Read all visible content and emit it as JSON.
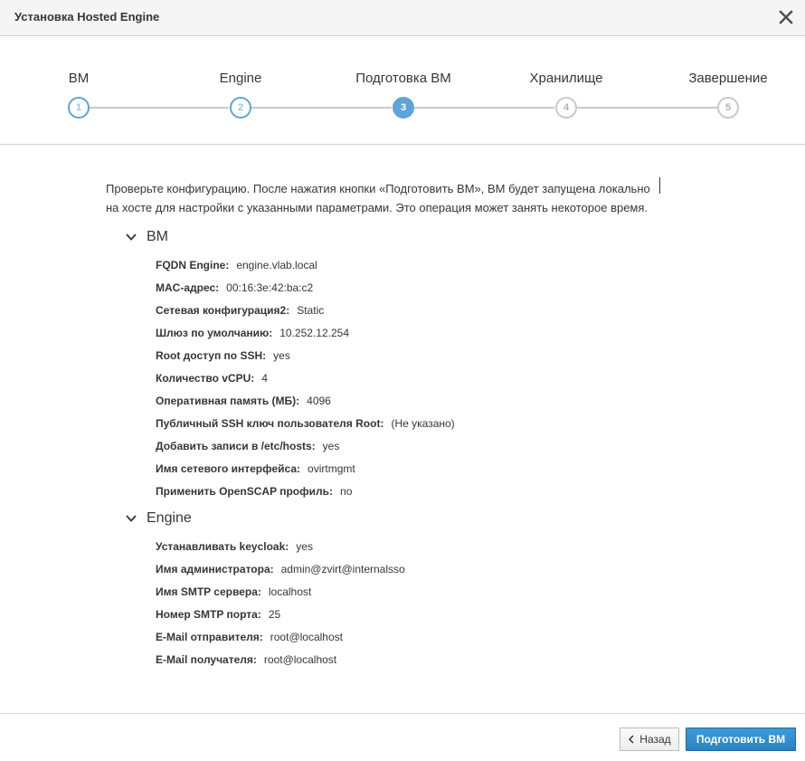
{
  "dialog": {
    "title": "Установка Hosted Engine"
  },
  "steps": [
    {
      "label": "ВМ",
      "number": "1",
      "state": "done"
    },
    {
      "label": "Engine",
      "number": "2",
      "state": "done"
    },
    {
      "label": "Подготовка ВМ",
      "number": "3",
      "state": "current"
    },
    {
      "label": "Хранилище",
      "number": "4",
      "state": "todo"
    },
    {
      "label": "Завершение",
      "number": "5",
      "state": "todo"
    }
  ],
  "intro": {
    "line1": "Проверьте конфигурацию. После нажатия кнопки «Подготовить ВМ», ВМ будет запущена локально",
    "line2": "на хосте для настройки с указанными параметрами. Это операция может занять некоторое время."
  },
  "vm_section": {
    "title": "ВМ",
    "rows": [
      {
        "key": "FQDN Engine:",
        "value": "engine.vlab.local"
      },
      {
        "key": "MAC-адрес:",
        "value": "00:16:3e:42:ba:c2"
      },
      {
        "key": "Сетевая конфигурация2:",
        "value": "Static"
      },
      {
        "key": "Шлюз по умолчанию:",
        "value": "10.252.12.254"
      },
      {
        "key": "Root доступ по SSH:",
        "value": "yes"
      },
      {
        "key": "Количество vCPU:",
        "value": "4"
      },
      {
        "key": "Оперативная память (МБ):",
        "value": "4096"
      },
      {
        "key": "Публичный SSH ключ пользователя Root:",
        "value": "(Не указано)"
      },
      {
        "key": "Добавить записи в /etc/hosts:",
        "value": "yes"
      },
      {
        "key": "Имя сетевого интерфейса:",
        "value": "ovirtmgmt"
      },
      {
        "key": "Применить OpenSCAP профиль:",
        "value": "no"
      }
    ]
  },
  "engine_section": {
    "title": "Engine",
    "rows": [
      {
        "key": "Устанавливать keycloak:",
        "value": "yes"
      },
      {
        "key": "Имя администратора:",
        "value": "admin@zvirt@internalsso"
      },
      {
        "key": "Имя SMTP сервера:",
        "value": "localhost"
      },
      {
        "key": "Номер SMTP порта:",
        "value": "25"
      },
      {
        "key": "E-Mail отправителя:",
        "value": "root@localhost"
      },
      {
        "key": "E-Mail получателя:",
        "value": "root@localhost"
      }
    ]
  },
  "footer": {
    "back_label": "Назад",
    "primary_label": "Подготовить ВМ"
  },
  "icons": {
    "close": "close-icon",
    "chevron": "chevron-down-icon",
    "back": "chevron-left-icon"
  },
  "colors": {
    "accent": "#5ea4d9",
    "primary_button": "#2b83c4",
    "inactive_step": "#c9c9c9"
  }
}
